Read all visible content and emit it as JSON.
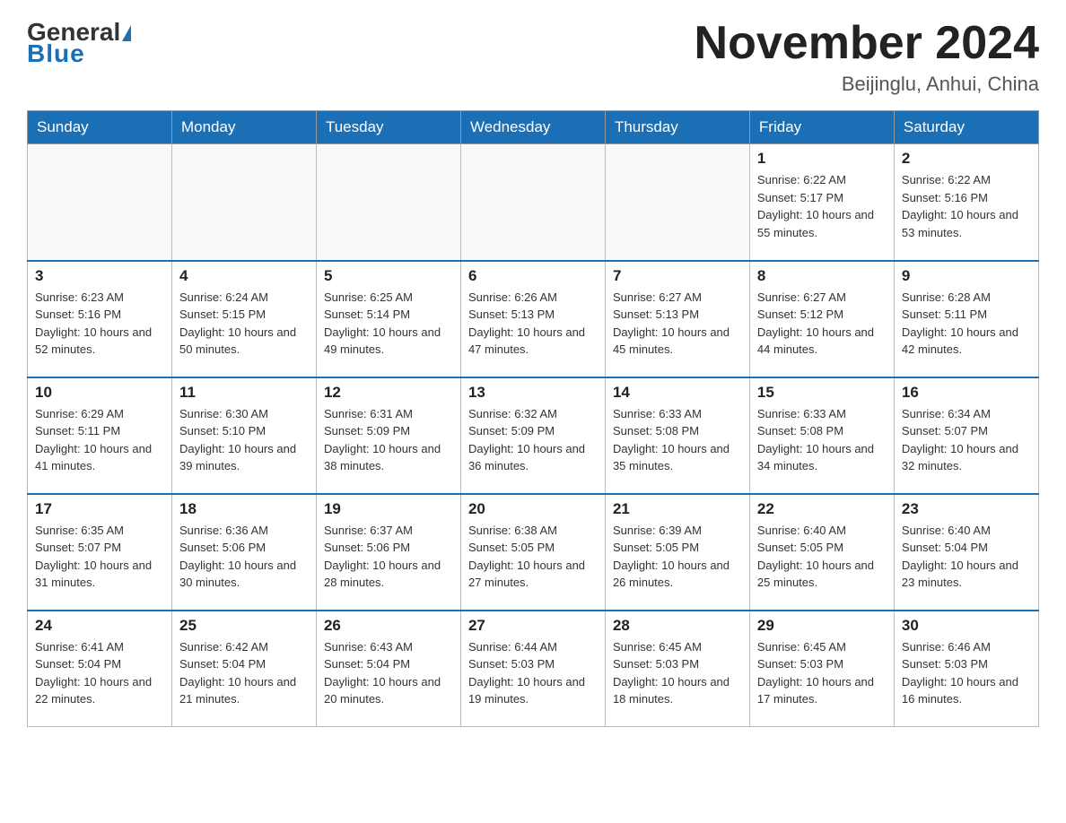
{
  "header": {
    "logo": {
      "general": "General",
      "blue": "Blue"
    },
    "title": "November 2024",
    "location": "Beijinglu, Anhui, China"
  },
  "days_of_week": [
    "Sunday",
    "Monday",
    "Tuesday",
    "Wednesday",
    "Thursday",
    "Friday",
    "Saturday"
  ],
  "weeks": [
    [
      {
        "day": null,
        "info": null
      },
      {
        "day": null,
        "info": null
      },
      {
        "day": null,
        "info": null
      },
      {
        "day": null,
        "info": null
      },
      {
        "day": null,
        "info": null
      },
      {
        "day": "1",
        "sunrise": "6:22 AM",
        "sunset": "5:17 PM",
        "daylight": "10 hours and 55 minutes."
      },
      {
        "day": "2",
        "sunrise": "6:22 AM",
        "sunset": "5:16 PM",
        "daylight": "10 hours and 53 minutes."
      }
    ],
    [
      {
        "day": "3",
        "sunrise": "6:23 AM",
        "sunset": "5:16 PM",
        "daylight": "10 hours and 52 minutes."
      },
      {
        "day": "4",
        "sunrise": "6:24 AM",
        "sunset": "5:15 PM",
        "daylight": "10 hours and 50 minutes."
      },
      {
        "day": "5",
        "sunrise": "6:25 AM",
        "sunset": "5:14 PM",
        "daylight": "10 hours and 49 minutes."
      },
      {
        "day": "6",
        "sunrise": "6:26 AM",
        "sunset": "5:13 PM",
        "daylight": "10 hours and 47 minutes."
      },
      {
        "day": "7",
        "sunrise": "6:27 AM",
        "sunset": "5:13 PM",
        "daylight": "10 hours and 45 minutes."
      },
      {
        "day": "8",
        "sunrise": "6:27 AM",
        "sunset": "5:12 PM",
        "daylight": "10 hours and 44 minutes."
      },
      {
        "day": "9",
        "sunrise": "6:28 AM",
        "sunset": "5:11 PM",
        "daylight": "10 hours and 42 minutes."
      }
    ],
    [
      {
        "day": "10",
        "sunrise": "6:29 AM",
        "sunset": "5:11 PM",
        "daylight": "10 hours and 41 minutes."
      },
      {
        "day": "11",
        "sunrise": "6:30 AM",
        "sunset": "5:10 PM",
        "daylight": "10 hours and 39 minutes."
      },
      {
        "day": "12",
        "sunrise": "6:31 AM",
        "sunset": "5:09 PM",
        "daylight": "10 hours and 38 minutes."
      },
      {
        "day": "13",
        "sunrise": "6:32 AM",
        "sunset": "5:09 PM",
        "daylight": "10 hours and 36 minutes."
      },
      {
        "day": "14",
        "sunrise": "6:33 AM",
        "sunset": "5:08 PM",
        "daylight": "10 hours and 35 minutes."
      },
      {
        "day": "15",
        "sunrise": "6:33 AM",
        "sunset": "5:08 PM",
        "daylight": "10 hours and 34 minutes."
      },
      {
        "day": "16",
        "sunrise": "6:34 AM",
        "sunset": "5:07 PM",
        "daylight": "10 hours and 32 minutes."
      }
    ],
    [
      {
        "day": "17",
        "sunrise": "6:35 AM",
        "sunset": "5:07 PM",
        "daylight": "10 hours and 31 minutes."
      },
      {
        "day": "18",
        "sunrise": "6:36 AM",
        "sunset": "5:06 PM",
        "daylight": "10 hours and 30 minutes."
      },
      {
        "day": "19",
        "sunrise": "6:37 AM",
        "sunset": "5:06 PM",
        "daylight": "10 hours and 28 minutes."
      },
      {
        "day": "20",
        "sunrise": "6:38 AM",
        "sunset": "5:05 PM",
        "daylight": "10 hours and 27 minutes."
      },
      {
        "day": "21",
        "sunrise": "6:39 AM",
        "sunset": "5:05 PM",
        "daylight": "10 hours and 26 minutes."
      },
      {
        "day": "22",
        "sunrise": "6:40 AM",
        "sunset": "5:05 PM",
        "daylight": "10 hours and 25 minutes."
      },
      {
        "day": "23",
        "sunrise": "6:40 AM",
        "sunset": "5:04 PM",
        "daylight": "10 hours and 23 minutes."
      }
    ],
    [
      {
        "day": "24",
        "sunrise": "6:41 AM",
        "sunset": "5:04 PM",
        "daylight": "10 hours and 22 minutes."
      },
      {
        "day": "25",
        "sunrise": "6:42 AM",
        "sunset": "5:04 PM",
        "daylight": "10 hours and 21 minutes."
      },
      {
        "day": "26",
        "sunrise": "6:43 AM",
        "sunset": "5:04 PM",
        "daylight": "10 hours and 20 minutes."
      },
      {
        "day": "27",
        "sunrise": "6:44 AM",
        "sunset": "5:03 PM",
        "daylight": "10 hours and 19 minutes."
      },
      {
        "day": "28",
        "sunrise": "6:45 AM",
        "sunset": "5:03 PM",
        "daylight": "10 hours and 18 minutes."
      },
      {
        "day": "29",
        "sunrise": "6:45 AM",
        "sunset": "5:03 PM",
        "daylight": "10 hours and 17 minutes."
      },
      {
        "day": "30",
        "sunrise": "6:46 AM",
        "sunset": "5:03 PM",
        "daylight": "10 hours and 16 minutes."
      }
    ]
  ]
}
